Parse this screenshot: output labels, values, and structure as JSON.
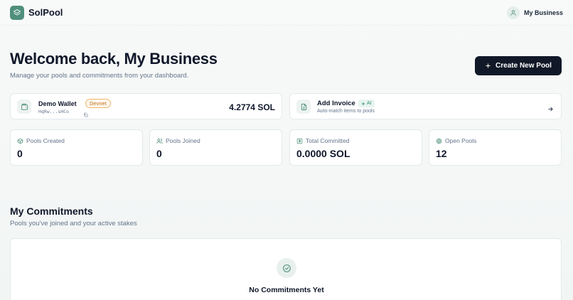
{
  "header": {
    "brand": "SolPool",
    "user_name": "My Business"
  },
  "hero": {
    "title": "Welcome back, My Business",
    "subtitle": "Manage your pools and commitments from your dashboard.",
    "create_button_label": "Create New Pool"
  },
  "wallet": {
    "label": "Demo Wallet",
    "network_badge": "Devnet",
    "address": "HqRw...sHCo",
    "balance": "4.2774 SOL"
  },
  "invoice": {
    "title": "Add Invoice",
    "badge": "AI",
    "subtitle": "Auto-match items to pools"
  },
  "stats": [
    {
      "label": "Pools Created",
      "value": "0",
      "icon": "box-icon"
    },
    {
      "label": "Pools Joined",
      "value": "0",
      "icon": "users-icon"
    },
    {
      "label": "Total Committed",
      "value": "0.0000 SOL",
      "icon": "dollar-icon"
    },
    {
      "label": "Open Pools",
      "value": "12",
      "icon": "target-icon"
    }
  ],
  "commitments": {
    "title": "My Commitments",
    "subtitle": "Pools you've joined and your active stakes",
    "empty_title": "No Commitments Yet"
  },
  "colors": {
    "accent": "#4f8f7c",
    "primary_button": "#111827",
    "devnet_border": "#f0b36a",
    "ai_badge_text": "#3b8d72"
  }
}
